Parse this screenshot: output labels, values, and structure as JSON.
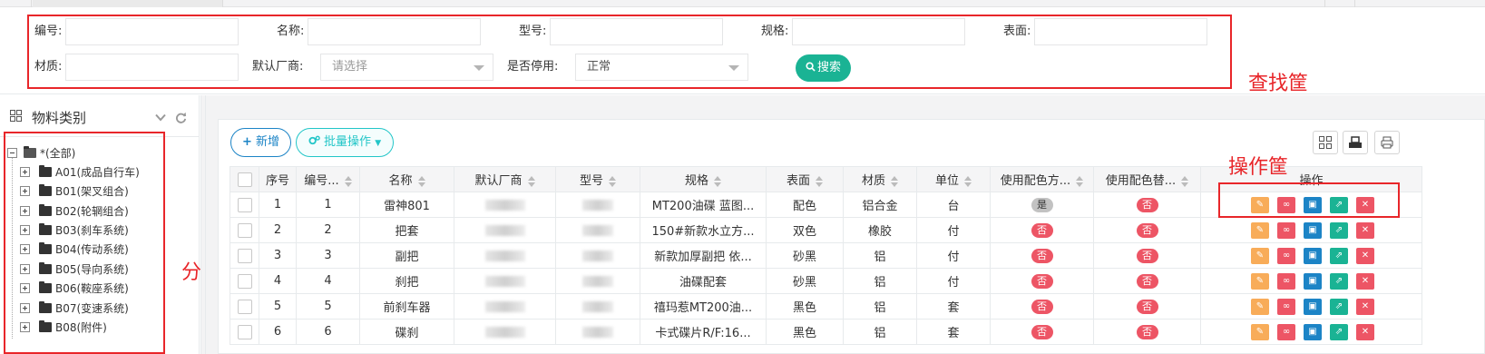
{
  "search": {
    "code_label": "编号:",
    "name_label": "名称:",
    "model_label": "型号:",
    "spec_label": "规格:",
    "surface_label": "表面:",
    "material_label": "材质:",
    "vendor_label": "默认厂商:",
    "vendor_placeholder": "请选择",
    "disabled_label": "是否停用:",
    "disabled_value": "正常",
    "search_button": "搜索",
    "annotation": "查找筐"
  },
  "sidebar": {
    "title": "物料类别",
    "annotation": "分类筐",
    "root": "*(全部)",
    "items": [
      {
        "label": "A01(成品自行车)"
      },
      {
        "label": "B01(架叉组合)"
      },
      {
        "label": "B02(轮辋组合)"
      },
      {
        "label": "B03(刹车系统)"
      },
      {
        "label": "B04(传动系统)"
      },
      {
        "label": "B05(导向系统)"
      },
      {
        "label": "B06(鞍座系统)"
      },
      {
        "label": "B07(变速系统)"
      },
      {
        "label": "B08(附件)"
      }
    ]
  },
  "toolbar": {
    "add_label": "新增",
    "batch_label": "批量操作",
    "annotation": "操作筐"
  },
  "table": {
    "headers": [
      "序号",
      "编号...",
      "名称",
      "默认厂商",
      "型号",
      "规格",
      "表面",
      "材质",
      "单位",
      "使用配色方...",
      "使用配色替...",
      "操作"
    ],
    "rows": [
      {
        "seq": "1",
        "code": "1",
        "name": "雷神801",
        "spec": "MT200油碟 蓝图...",
        "surface": "配色",
        "material": "铝合金",
        "unit": "台",
        "use_scheme": "是",
        "use_replace": "否"
      },
      {
        "seq": "2",
        "code": "2",
        "name": "把套",
        "spec": "150#新款水立方...",
        "surface": "双色",
        "material": "橡胶",
        "unit": "付",
        "use_scheme": "否",
        "use_replace": "否"
      },
      {
        "seq": "3",
        "code": "3",
        "name": "副把",
        "spec": "新款加厚副把 依...",
        "surface": "砂黑",
        "material": "铝",
        "unit": "付",
        "use_scheme": "否",
        "use_replace": "否"
      },
      {
        "seq": "4",
        "code": "4",
        "name": "刹把",
        "spec": "油碟配套",
        "surface": "砂黑",
        "material": "铝",
        "unit": "付",
        "use_scheme": "否",
        "use_replace": "否"
      },
      {
        "seq": "5",
        "code": "5",
        "name": "前刹车器",
        "spec": "禧玛惹MT200油...",
        "surface": "黑色",
        "material": "铝",
        "unit": "套",
        "use_scheme": "否",
        "use_replace": "否"
      },
      {
        "seq": "6",
        "code": "6",
        "name": "碟刹",
        "spec": "卡式碟片R/F:16...",
        "surface": "黑色",
        "material": "铝",
        "unit": "套",
        "use_scheme": "否",
        "use_replace": "否"
      }
    ]
  },
  "colors": {
    "primary": "#1ab394",
    "blue": "#1c84c6",
    "info": "#23c6c8",
    "danger": "#ed5565",
    "warning": "#f8ac59",
    "annotation_red": "#e8262a"
  }
}
